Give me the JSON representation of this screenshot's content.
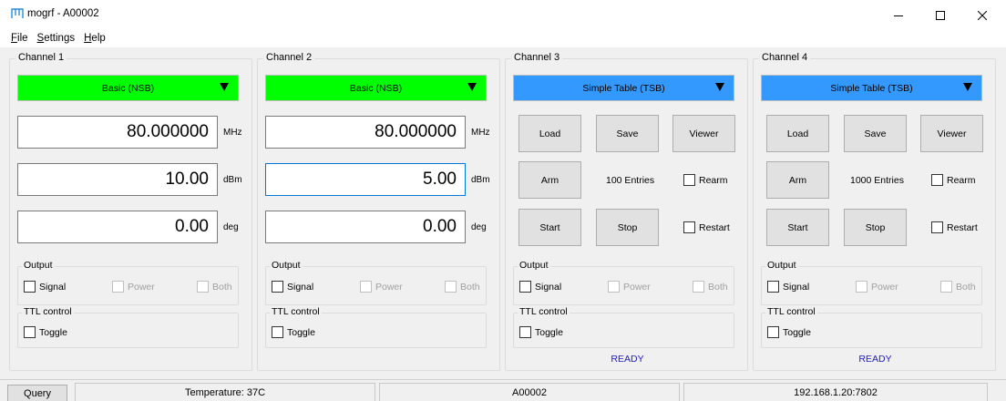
{
  "window": {
    "title": "mogrf - A00002",
    "app_icon": "m-logo-icon",
    "controls": [
      "minimize-icon",
      "maximize-icon",
      "close-icon"
    ]
  },
  "menu": {
    "file": "File",
    "settings": "Settings",
    "help": "Help"
  },
  "colors": {
    "basic_mode": "#00ff00",
    "table_mode": "#3399ff",
    "ready_text": "#2020c0",
    "focus_border": "#0078d7"
  },
  "channels": [
    {
      "label": "Channel 1",
      "mode": "Basic (NSB)",
      "frequency": "80.000000",
      "frequency_unit": "MHz",
      "power": "10.00",
      "power_unit": "dBm",
      "phase": "0.00",
      "phase_unit": "deg",
      "output_label": "Output",
      "signal": "Signal",
      "power_chk": "Power",
      "both": "Both",
      "ttl_label": "TTL control",
      "toggle": "Toggle"
    },
    {
      "label": "Channel 2",
      "mode": "Basic (NSB)",
      "frequency": "80.000000",
      "frequency_unit": "MHz",
      "power": "5.00",
      "power_unit": "dBm",
      "phase": "0.00",
      "phase_unit": "deg",
      "output_label": "Output",
      "signal": "Signal",
      "power_chk": "Power",
      "both": "Both",
      "ttl_label": "TTL control",
      "toggle": "Toggle"
    },
    {
      "label": "Channel 3",
      "mode": "Simple Table (TSB)",
      "load": "Load",
      "save": "Save",
      "viewer": "Viewer",
      "arm": "Arm",
      "entries": "100 Entries",
      "rearm": "Rearm",
      "start": "Start",
      "stop": "Stop",
      "restart": "Restart",
      "output_label": "Output",
      "signal": "Signal",
      "power_chk": "Power",
      "both": "Both",
      "ttl_label": "TTL control",
      "toggle": "Toggle",
      "status": "READY"
    },
    {
      "label": "Channel 4",
      "mode": "Simple Table (TSB)",
      "load": "Load",
      "save": "Save",
      "viewer": "Viewer",
      "arm": "Arm",
      "entries": "1000 Entries",
      "rearm": "Rearm",
      "start": "Start",
      "stop": "Stop",
      "restart": "Restart",
      "output_label": "Output",
      "signal": "Signal",
      "power_chk": "Power",
      "both": "Both",
      "ttl_label": "TTL control",
      "toggle": "Toggle",
      "status": "READY"
    }
  ],
  "statusbar": {
    "query": "Query",
    "temperature": "Temperature: 37C",
    "serial": "A00002",
    "address": "192.168.1.20:7802"
  }
}
